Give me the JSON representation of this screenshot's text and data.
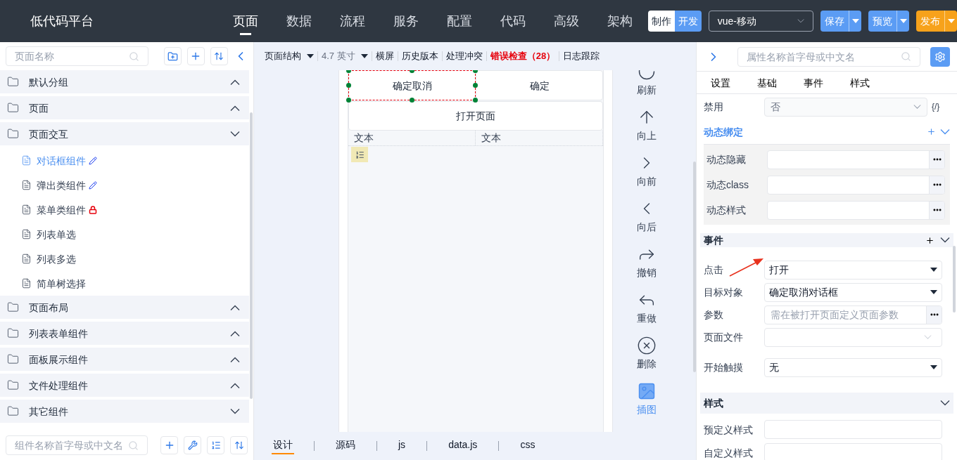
{
  "header": {
    "logo": "低代码平台",
    "nav": [
      {
        "label": "页面",
        "selected": true
      },
      {
        "label": "数据",
        "selected": false
      },
      {
        "label": "流程",
        "selected": false
      },
      {
        "label": "服务",
        "selected": false
      },
      {
        "label": "配置",
        "selected": false
      },
      {
        "label": "代码",
        "selected": false
      },
      {
        "label": "高级",
        "selected": false
      },
      {
        "label": "架构",
        "selected": false
      }
    ],
    "mode": [
      {
        "label": "制作",
        "selected": false
      },
      {
        "label": "开发",
        "selected": true
      }
    ],
    "platform": "vue-移动",
    "actions": [
      {
        "label": "保存",
        "color": "#5b9cf4"
      },
      {
        "label": "预览",
        "color": "#5b9cf4"
      },
      {
        "label": "发布",
        "color": "#f7a21b"
      }
    ]
  },
  "left": {
    "search": {
      "placeholder": "页面名称"
    },
    "groups": [
      {
        "label": "默认分组",
        "expanded": false
      },
      {
        "label": "页面",
        "expanded": false
      },
      {
        "label": "页面交互",
        "expanded": true,
        "children": [
          {
            "label": "对话框组件",
            "selected": true,
            "kind": "editable"
          },
          {
            "label": "弹出类组件",
            "selected": false,
            "kind": "editable"
          },
          {
            "label": "菜单类组件",
            "selected": false,
            "kind": "locked"
          },
          {
            "label": "列表单选",
            "selected": false,
            "kind": "plain"
          },
          {
            "label": "列表多选",
            "selected": false,
            "kind": "plain"
          },
          {
            "label": "简单树选择",
            "selected": false,
            "kind": "plain"
          }
        ]
      },
      {
        "label": "页面布局",
        "expanded": false
      },
      {
        "label": "列表表单组件",
        "expanded": false
      },
      {
        "label": "面板展示组件",
        "expanded": false
      },
      {
        "label": "文件处理组件",
        "expanded": false
      },
      {
        "label": "其它组件",
        "expanded": true
      }
    ],
    "bottom_search": {
      "placeholder": "组件名称首字母或中文名"
    }
  },
  "center": {
    "toolbar": [
      {
        "label": "页面结构",
        "kind": "dropdown"
      },
      {
        "label": "4.7 英寸",
        "kind": "muted-dropdown"
      },
      {
        "label": "横屏",
        "kind": "plain"
      },
      {
        "label": "历史版本",
        "kind": "plain"
      },
      {
        "label": "处理冲突",
        "kind": "plain"
      },
      {
        "label": "错误检查（28）",
        "kind": "error"
      },
      {
        "label": "日志跟踪",
        "kind": "plain"
      }
    ],
    "canvas": {
      "button_row": [
        {
          "label": "确定取消",
          "selected": true
        },
        {
          "label": "确定",
          "selected": false
        }
      ],
      "wide_button": "打开页面",
      "table_headers": [
        "文本",
        "文本"
      ]
    },
    "tools": [
      {
        "label": "刷新",
        "kind": "refresh",
        "active": false
      },
      {
        "label": "向上",
        "kind": "up",
        "active": false
      },
      {
        "label": "向前",
        "kind": "forward",
        "active": false
      },
      {
        "label": "向后",
        "kind": "back",
        "active": false
      },
      {
        "label": "撤销",
        "kind": "undo",
        "active": false
      },
      {
        "label": "重做",
        "kind": "redo",
        "active": false
      },
      {
        "label": "删除",
        "kind": "delete",
        "active": false
      },
      {
        "label": "插图",
        "kind": "image",
        "active": true
      }
    ],
    "tabs": [
      {
        "label": "设计",
        "selected": true
      },
      {
        "label": "源码",
        "selected": false
      },
      {
        "label": "js",
        "selected": false
      },
      {
        "label": "data.js",
        "selected": false
      },
      {
        "label": "css",
        "selected": false
      }
    ]
  },
  "right": {
    "search": {
      "placeholder": "属性名称首字母或中文名"
    },
    "tabs": [
      "设置",
      "基础",
      "事件",
      "样式"
    ],
    "disabled_row": {
      "label": "禁用",
      "value": "否",
      "expr": "{/}"
    },
    "binding": {
      "title": "动态绑定",
      "rows": [
        "动态隐藏",
        "动态class",
        "动态样式"
      ]
    },
    "events": {
      "title": "事件",
      "rows": [
        {
          "label": "点击",
          "kind": "select",
          "value": "打开"
        },
        {
          "label": "目标对象",
          "kind": "select",
          "value": "确定取消对话框"
        },
        {
          "label": "参数",
          "kind": "more",
          "placeholder": "需在被打开页面定义页面参数"
        },
        {
          "label": "页面文件",
          "kind": "combo"
        },
        {
          "label": "开始触摸",
          "kind": "select",
          "value": "无"
        }
      ]
    },
    "style": {
      "title": "样式",
      "rows": [
        "预定义样式",
        "自定义样式"
      ]
    }
  }
}
